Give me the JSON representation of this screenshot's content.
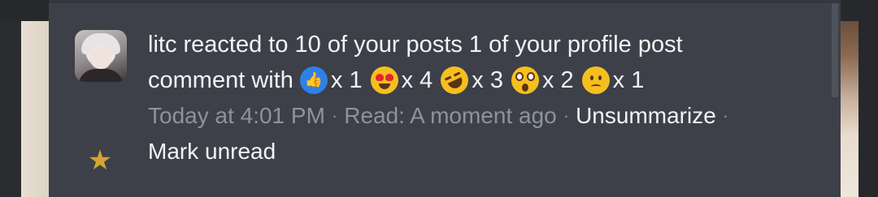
{
  "notification": {
    "user": "litc",
    "line1": "litc reacted to 10 of your posts 1 of your profile post",
    "line2_prefix": "comment with",
    "reactions": [
      {
        "icon": "like-reaction-icon",
        "count": "x 1"
      },
      {
        "icon": "love-reaction-icon",
        "count": "x 4"
      },
      {
        "icon": "haha-reaction-icon",
        "count": "x 3"
      },
      {
        "icon": "wow-reaction-icon",
        "count": "x 2"
      },
      {
        "icon": "sad-reaction-icon",
        "count": "x 1"
      }
    ],
    "time": "Today at 4:01 PM",
    "separator": "·",
    "read_status": "Read: A moment ago",
    "unsummarize_label": "Unsummarize",
    "mark_unread_label": "Mark unread",
    "star_icon": "star-icon"
  },
  "colors": {
    "panel_bg": "#3d4048",
    "text": "#f2f3f5",
    "muted_text": "#8d929b",
    "star": "#d4a531",
    "like_blue": "#2f80e8"
  }
}
